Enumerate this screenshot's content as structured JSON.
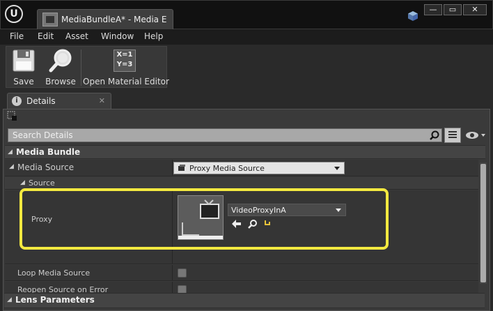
{
  "window": {
    "tab_title": "MediaBundleA* - Media E",
    "controls": {
      "minimize": "—",
      "maximize": "▭",
      "close": "✕"
    }
  },
  "menu": [
    "File",
    "Edit",
    "Asset",
    "Window",
    "Help"
  ],
  "toolbar": {
    "save_label": "Save",
    "browse_label": "Browse",
    "open_material_label": "Open Material Editor",
    "material_icon_line1": "X=1",
    "material_icon_line2": "Y=3"
  },
  "details": {
    "tab_label": "Details",
    "tab_close": "✕",
    "info_glyph": "i",
    "search_placeholder": "Search Details",
    "categories": {
      "media_bundle": "Media Bundle",
      "source": "Source",
      "lens_parameters": "Lens Parameters"
    },
    "properties": {
      "media_source_label": "Media Source",
      "media_source_value": "Proxy Media Source",
      "proxy_label": "Proxy",
      "proxy_value": "VideoProxyInA",
      "loop_label": "Loop Media Source",
      "reopen_label": "Reopen Source on Error"
    }
  },
  "colors": {
    "highlight": "#f3e940",
    "panel_bg": "#3a3a3a",
    "combo_bg": "#e4e4e4"
  }
}
